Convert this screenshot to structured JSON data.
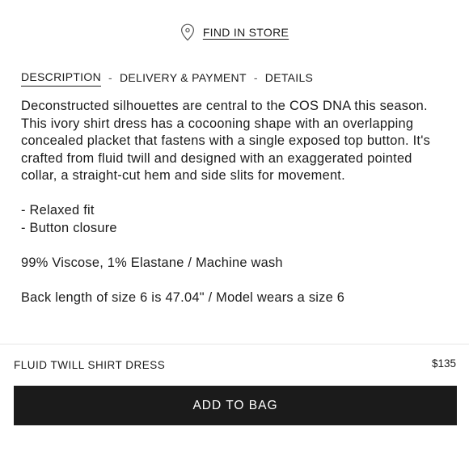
{
  "store_link": {
    "label": "FIND IN STORE",
    "icon": "location-pin-icon"
  },
  "tabs": [
    {
      "label": "DESCRIPTION",
      "active": true
    },
    {
      "label": "DELIVERY & PAYMENT",
      "active": false
    },
    {
      "label": "DETAILS",
      "active": false
    }
  ],
  "tab_separator": "-",
  "description": {
    "paragraph": "Deconstructed silhouettes are central to the COS DNA this season. This ivory shirt dress has a cocooning shape with an overlapping concealed placket that fastens with a single exposed top button. It's crafted from fluid twill and designed with an exaggerated pointed collar, a straight-cut hem and side slits for movement.",
    "features": [
      "- Relaxed fit",
      "- Button closure"
    ],
    "composition": "99% Viscose, 1% Elastane / Machine wash",
    "measurements": "Back length of size 6 is 47.04\" / Model wears a size 6"
  },
  "product": {
    "name": "FLUID TWILL SHIRT DRESS",
    "price": "$135"
  },
  "cta": {
    "label": "ADD TO BAG"
  }
}
